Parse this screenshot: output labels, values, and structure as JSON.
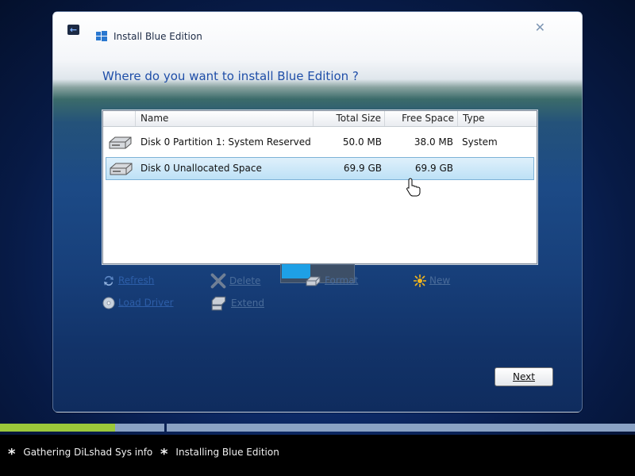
{
  "window": {
    "title": "Install Blue Edition",
    "heading": "Where do you want to install Blue Edition ?",
    "close_glyph": "✕"
  },
  "table": {
    "columns": [
      "Name",
      "Total Size",
      "Free Space",
      "Type"
    ],
    "rows": [
      {
        "name": "Disk 0 Partition 1: System Reserved",
        "total": "50.0 MB",
        "free": "38.0 MB",
        "type": "System",
        "selected": false
      },
      {
        "name": "Disk 0 Unallocated Space",
        "total": "69.9 GB",
        "free": "69.9 GB",
        "type": "",
        "selected": true
      }
    ]
  },
  "actions": {
    "refresh": "Refresh",
    "delete": "Delete",
    "format": "Format",
    "new": "New",
    "load_driver": "Load Driver",
    "extend": "Extend"
  },
  "buttons": {
    "next": "Next"
  },
  "progress": {
    "step1_fraction": 0.7
  },
  "status": {
    "step1": "Gathering DiLshad Sys info",
    "step2": "Installing Blue Edition",
    "bullet": "*"
  },
  "colors": {
    "heading": "#1f4ea8",
    "progress_fill": "#9bc83a",
    "selection": "#bde1f6"
  },
  "icons": [
    "back-arrow-icon",
    "windows-logo-icon",
    "close-icon",
    "disk-icon",
    "refresh-icon",
    "delete-icon",
    "format-icon",
    "new-icon",
    "load-driver-icon",
    "extend-icon",
    "hand-cursor-icon",
    "star-bullet-icon"
  ]
}
